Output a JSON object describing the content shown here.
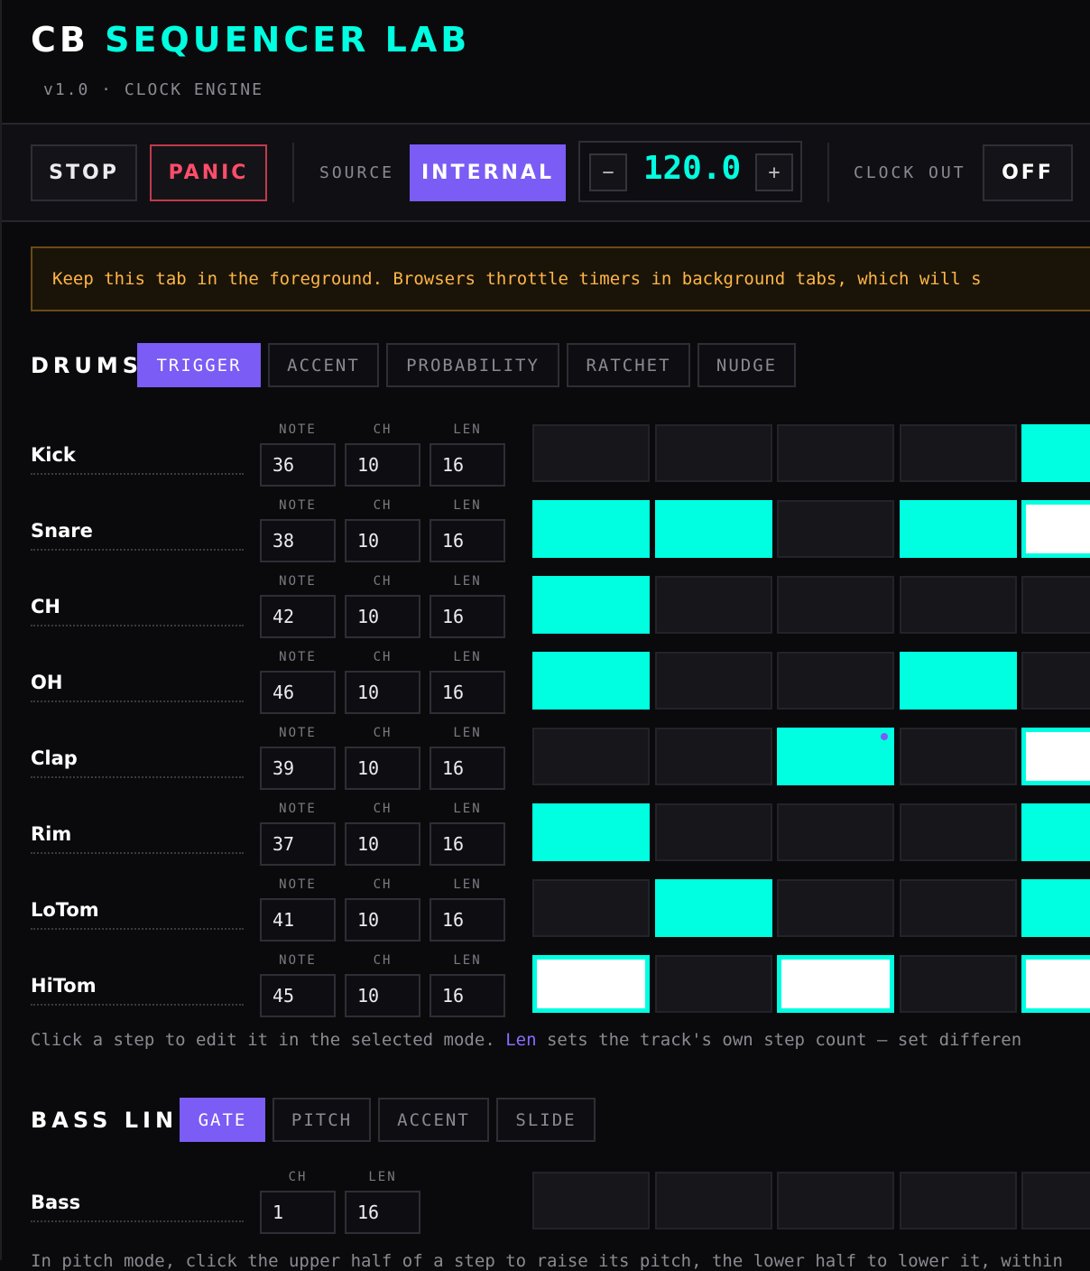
{
  "header": {
    "brand": "CB",
    "title": "SEQUENCER LAB",
    "subtitle": "v1.0 · CLOCK ENGINE"
  },
  "toolbar": {
    "stop_label": "STOP",
    "panic_label": "PANIC",
    "source_label": "SOURCE",
    "source_value": "INTERNAL",
    "bpm_minus": "−",
    "bpm_value": "120.0",
    "bpm_plus": "+",
    "clock_out_label": "CLOCK OUT",
    "clock_out_value": "OFF"
  },
  "warning": "Keep this tab in the foreground. Browsers throttle timers in background tabs, which will s",
  "drums": {
    "title": "DRUMS",
    "tabs": [
      "TRIGGER",
      "ACCENT",
      "PROBABILITY",
      "RATCHET",
      "NUDGE"
    ],
    "active_tab": "TRIGGER",
    "field_labels": {
      "note": "NOTE",
      "ch": "CH",
      "len": "LEN"
    },
    "tracks": [
      {
        "name": "Kick",
        "note": "36",
        "ch": "10",
        "len": "16",
        "steps": [
          "off",
          "off",
          "off",
          "off",
          "on"
        ]
      },
      {
        "name": "Snare",
        "note": "38",
        "ch": "10",
        "len": "16",
        "steps": [
          "on",
          "on",
          "off",
          "on",
          "cur"
        ]
      },
      {
        "name": "CH",
        "note": "42",
        "ch": "10",
        "len": "16",
        "steps": [
          "on",
          "off",
          "off",
          "off",
          "off"
        ]
      },
      {
        "name": "OH",
        "note": "46",
        "ch": "10",
        "len": "16",
        "steps": [
          "on",
          "off",
          "off",
          "on",
          "off"
        ]
      },
      {
        "name": "Clap",
        "note": "39",
        "ch": "10",
        "len": "16",
        "steps": [
          "off",
          "off",
          "on-dot",
          "off",
          "cur"
        ]
      },
      {
        "name": "Rim",
        "note": "37",
        "ch": "10",
        "len": "16",
        "steps": [
          "on",
          "off",
          "off",
          "off",
          "on"
        ]
      },
      {
        "name": "LoTom",
        "note": "41",
        "ch": "10",
        "len": "16",
        "steps": [
          "off",
          "on",
          "off",
          "off",
          "on"
        ]
      },
      {
        "name": "HiTom",
        "note": "45",
        "ch": "10",
        "len": "16",
        "steps": [
          "cur",
          "off",
          "cur",
          "off",
          "cur"
        ]
      }
    ],
    "hint_a": "Click a step to edit it in the selected mode. ",
    "hint_hl": "Len",
    "hint_b": " sets the track's own step count — set differen"
  },
  "bass": {
    "title": "BASS LINE",
    "tabs": [
      "GATE",
      "PITCH",
      "ACCENT",
      "SLIDE"
    ],
    "active_tab": "GATE",
    "field_labels": {
      "ch": "CH",
      "len": "LEN"
    },
    "track": {
      "name": "Bass",
      "ch": "1",
      "len": "16",
      "steps": [
        "off",
        "off",
        "off",
        "off",
        "off"
      ]
    },
    "hint": "In pitch mode, click the upper half of a step to raise its pitch, the lower half to lower it, within"
  },
  "colors": {
    "accent": "#00ffe0",
    "purple": "#7b5cf5",
    "panic": "#ff4d6a",
    "warning": "#ffb547"
  }
}
